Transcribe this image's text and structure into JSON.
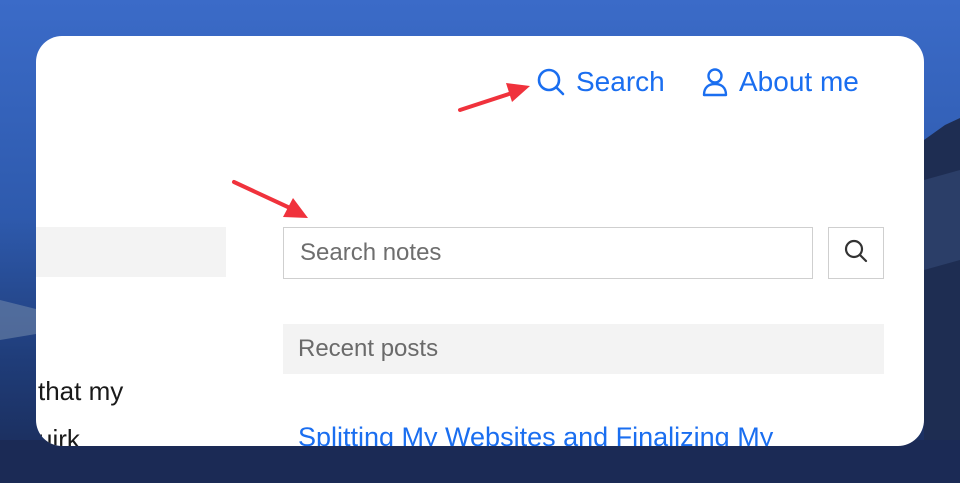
{
  "nav": {
    "search_label": "Search",
    "about_label": "About me"
  },
  "search": {
    "placeholder": "Search notes"
  },
  "sidebar": {
    "text_line_1": "that my",
    "text_line_2": "uirk"
  },
  "recent": {
    "heading": "Recent posts",
    "first_post": "Splitting My Websites and Finalizing My"
  },
  "colors": {
    "accent": "#1a6ef0",
    "annotation_arrow": "#f0323c",
    "card_background": "#ffffff",
    "field_background": "#f3f3f3"
  },
  "icons": {
    "nav_search": "search-icon",
    "nav_about": "user-icon",
    "search_button": "search-icon"
  }
}
